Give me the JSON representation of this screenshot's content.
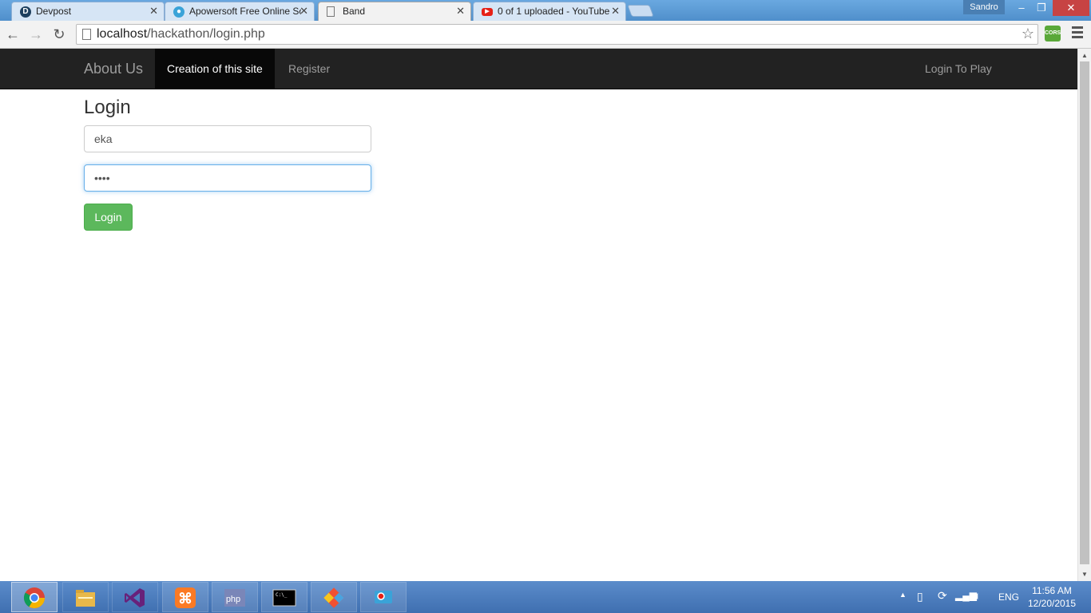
{
  "browser": {
    "tabs": [
      {
        "title": "Devpost",
        "icon": "devpost-icon",
        "favicon_letter": "D",
        "color": "#1d3f5e"
      },
      {
        "title": "Apowersoft Free Online Sc",
        "icon": "apowersoft-icon",
        "color": "#3aa3d8"
      },
      {
        "title": "Band",
        "icon": "page-icon",
        "active": true
      },
      {
        "title": "0 of 1 uploaded - YouTube",
        "icon": "youtube-icon",
        "color": "#e62117"
      }
    ],
    "profile_name": "Sandro",
    "url_host": "localhost",
    "url_path": "/hackathon/login.php",
    "extension_label": "CORS"
  },
  "site": {
    "brand": "About Us",
    "nav": [
      {
        "label": "Creation of this site",
        "active": true
      },
      {
        "label": "Register"
      }
    ],
    "nav_right": "Login To Play"
  },
  "login": {
    "title": "Login",
    "username_value": "eka",
    "password_value": "••••",
    "button_label": "Login"
  },
  "taskbar": {
    "apps": [
      "chrome-icon",
      "file-explorer-icon",
      "visual-studio-icon",
      "xampp-icon",
      "phpstorm-icon",
      "command-prompt-icon",
      "git-icon",
      "apowersoft-recorder-icon"
    ],
    "language": "ENG",
    "time": "11:56 AM",
    "date": "12/20/2015"
  }
}
